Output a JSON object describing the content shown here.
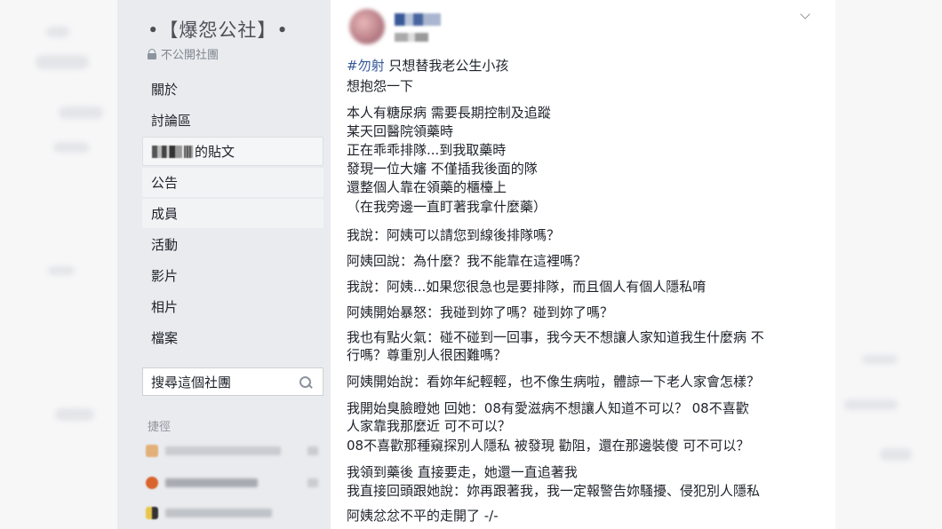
{
  "group": {
    "title": "•【爆怨公社】•",
    "privacy": "不公開社團"
  },
  "nav": {
    "about": "關於",
    "discussion": "討論區",
    "my_posts": "的貼文",
    "announcements": "公告",
    "members": "成員",
    "events": "活動",
    "videos": "影片",
    "photos": "相片",
    "files": "檔案"
  },
  "search": {
    "placeholder": "搜尋這個社團"
  },
  "shortcuts": {
    "label": "捷徑"
  },
  "post": {
    "hashtag": "#勿射",
    "title_rest": " 只想替我老公生小孩",
    "lines": [
      "想抱怨一下",
      "本人有糖尿病 需要長期控制及追蹤",
      "某天回醫院領藥時",
      "正在乖乖排隊...到我取藥時",
      "發現一位大嬸 不僅插我後面的隊",
      "還整個人靠在領藥的櫃檯上",
      "（在我旁邊一直盯著我拿什麼藥）",
      "我說：阿姨可以請您到線後排隊嗎？",
      "阿姨回說：為什麼？我不能靠在這裡嗎？",
      "我說：阿姨...如果您很急也是要排隊，而且個人有個人隱私唷",
      "阿姨開始暴怒：我碰到妳了嗎？碰到妳了嗎？",
      "我也有點火氣：碰不碰到一回事，我今天不想讓人家知道我生什麼病 不",
      "行嗎？尊重別人很困難嗎？",
      "阿姨開始說：看妳年紀輕輕，也不像生病啦，體諒一下老人家會怎樣？",
      "我開始臭臉瞪她 回她：08有愛滋病不想讓人知道不可以？ 08不喜歡",
      "人家靠我那麼近 可不可以？",
      "08不喜歡那種窺探別人隱私 被發現 勸阻，還在那邊裝傻 可不可以？",
      "我領到藥後 直接要走，她還一直追著我",
      "我直接回頭跟她說：妳再跟著我，我一定報警告妳騷擾、侵犯別人隱私",
      "阿姨忿忿不平的走開了 -/-"
    ]
  }
}
